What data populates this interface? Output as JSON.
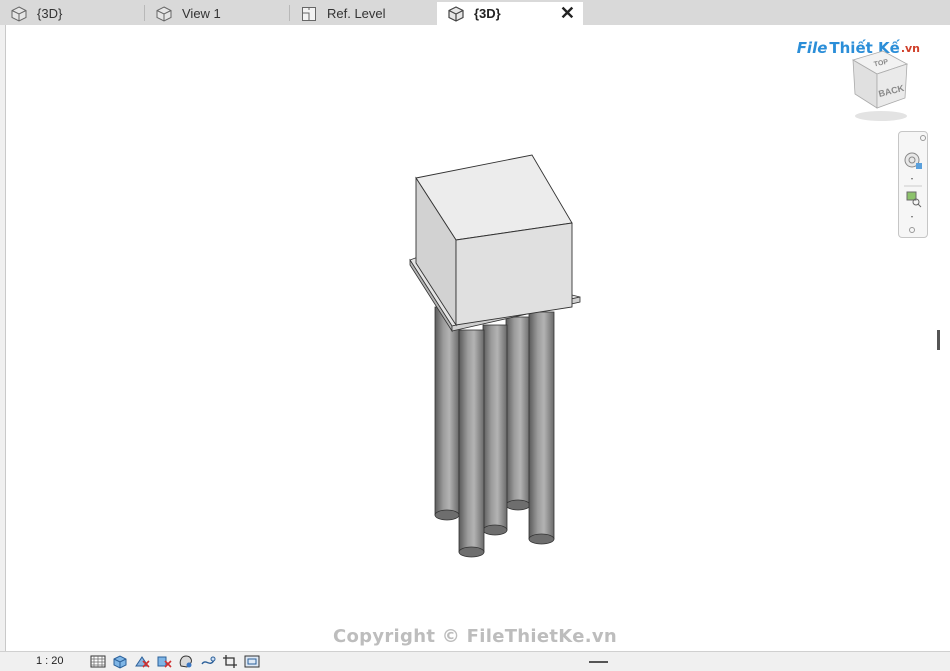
{
  "tabs": [
    {
      "label": "{3D}",
      "icon": "cube-3d-icon",
      "active": false
    },
    {
      "label": "View 1",
      "icon": "cube-3d-icon",
      "active": false
    },
    {
      "label": "Ref. Level",
      "icon": "plan-view-icon",
      "active": false
    },
    {
      "label": "{3D}",
      "icon": "cube-3d-icon",
      "active": true
    }
  ],
  "tab_close_label": "✕",
  "viewcube": {
    "top_label": "TOP",
    "back_label": "BACK"
  },
  "watermark": {
    "file": "File",
    "rest": "Thiết Kế",
    "vn": ".vn"
  },
  "copyright": "Copyright © FileThietKe.vn",
  "status": {
    "scale": "1 : 20",
    "icons": [
      "detail-level-icon",
      "visual-style-icon",
      "sun-path-off-icon",
      "shadows-off-icon",
      "render-icon",
      "lock-3d-view-icon",
      "crop-view-icon",
      "show-crop-region-icon"
    ]
  },
  "colors": {
    "tabbar": "#d9d9d9",
    "active_tab": "#ffffff",
    "model_gray": "#8c8c8c",
    "viewport": "#ffffff"
  }
}
